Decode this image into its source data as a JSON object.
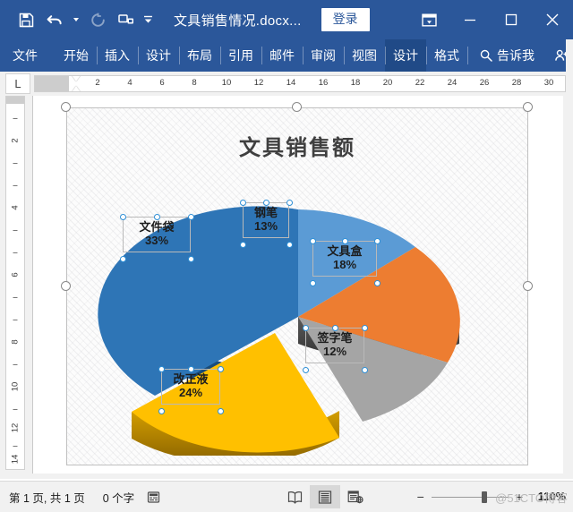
{
  "titlebar": {
    "document_name": "文具销售情况.docx...",
    "sign_in_label": "登录",
    "qat": [
      {
        "name": "save-icon",
        "label": "保存"
      },
      {
        "name": "undo-icon",
        "label": "撤消"
      },
      {
        "name": "redo-icon",
        "label": "恢复"
      },
      {
        "name": "touch-mouse-mode-icon",
        "label": "触摸/鼠标模式"
      },
      {
        "name": "customize-qat-icon",
        "label": "自定义快速访问工具栏"
      }
    ],
    "window_controls": [
      {
        "name": "ribbon-display-options-icon",
        "label": "功能区显示选项"
      },
      {
        "name": "minimize-icon",
        "label": "最小化"
      },
      {
        "name": "maximize-icon",
        "label": "最大化"
      },
      {
        "name": "close-icon",
        "label": "关闭"
      }
    ]
  },
  "ribbon": {
    "tabs": [
      {
        "label": "文件",
        "active": false
      },
      {
        "label": "开始",
        "active": false
      },
      {
        "label": "插入",
        "active": false
      },
      {
        "label": "设计",
        "active": false
      },
      {
        "label": "布局",
        "active": false
      },
      {
        "label": "引用",
        "active": false
      },
      {
        "label": "邮件",
        "active": false
      },
      {
        "label": "审阅",
        "active": false
      },
      {
        "label": "视图",
        "active": false
      },
      {
        "label": "设计",
        "active": true
      },
      {
        "label": "格式",
        "active": false
      }
    ],
    "tell_me": "告诉我",
    "share": "共享"
  },
  "ruler": {
    "tab_selector": "L",
    "horizontal_ticks": [
      "2",
      "4",
      "6",
      "8",
      "10",
      "12",
      "14",
      "16",
      "18",
      "20",
      "22",
      "24",
      "26",
      "28",
      "30"
    ],
    "vertical_ticks": [
      "2",
      "4",
      "6",
      "8",
      "10",
      "12",
      "14"
    ]
  },
  "chart_data": {
    "type": "pie",
    "title": "文具销售额",
    "categories": [
      "钢笔",
      "文具盒",
      "签字笔",
      "改正液",
      "文件袋"
    ],
    "values": [
      13,
      18,
      12,
      24,
      33
    ],
    "value_suffix": "%",
    "colors": [
      "#5b9bd5",
      "#ed7d31",
      "#a5a5a5",
      "#ffc000",
      "#2e75b6"
    ],
    "exploded": [
      "改正液"
    ],
    "three_d": true,
    "legend": "none",
    "labels": [
      {
        "name": "钢笔",
        "value": "13%"
      },
      {
        "name": "文具盒",
        "value": "18%"
      },
      {
        "name": "签字笔",
        "value": "12%"
      },
      {
        "name": "改正液",
        "value": "24%"
      },
      {
        "name": "文件袋",
        "value": "33%"
      }
    ]
  },
  "statusbar": {
    "pages": "第 1 页, 共 1 页",
    "words": "0 个字",
    "proofing_icon": "proofing-errors-icon",
    "views": [
      {
        "name": "read-mode-icon",
        "label": "阅读视图",
        "selected": false
      },
      {
        "name": "print-layout-icon",
        "label": "页面视图",
        "selected": true
      },
      {
        "name": "web-layout-icon",
        "label": "Web 版式视图",
        "selected": false
      }
    ],
    "zoom_out": "−",
    "zoom_in": "+",
    "zoom_level": "110%",
    "watermark": "@51CTO博客"
  }
}
